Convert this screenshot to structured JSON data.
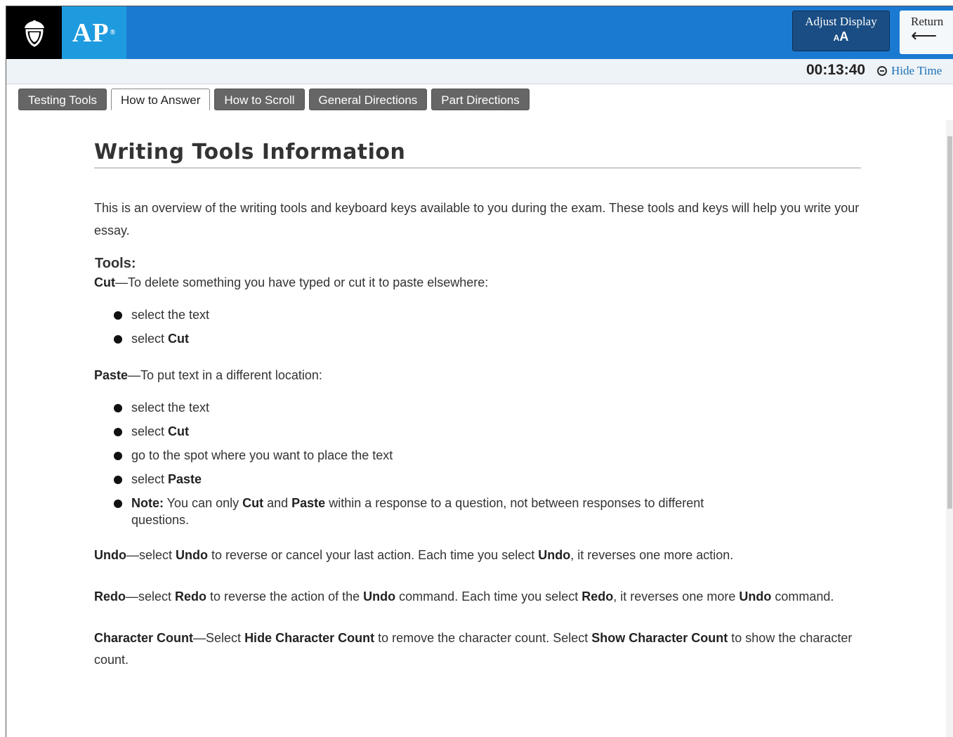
{
  "header": {
    "logo_text": "AP",
    "adjust_display": "Adjust Display",
    "adjust_icon": "AA",
    "return_label": "Return"
  },
  "timer": {
    "value": "00:13:40",
    "hide_label": "Hide Time"
  },
  "tabs": [
    {
      "label": "Testing Tools",
      "active": false
    },
    {
      "label": "How to Answer",
      "active": true
    },
    {
      "label": "How to Scroll",
      "active": false
    },
    {
      "label": "General Directions",
      "active": false
    },
    {
      "label": "Part Directions",
      "active": false
    }
  ],
  "content": {
    "title": "Writing Tools Information",
    "intro": "This is an overview of the writing tools and keyboard keys available to you during the exam. These tools and keys will help you write your essay.",
    "tools_heading": "Tools:",
    "cut": {
      "term": "Cut",
      "desc": "—To delete something you have typed or cut it to paste elsewhere:",
      "step1": "select the text",
      "step2_prefix": "select ",
      "step2_bold": "Cut"
    },
    "paste": {
      "term": "Paste",
      "desc": "—To put text in a different location:",
      "step1": "select the text",
      "step2_prefix": "select ",
      "step2_bold": "Cut",
      "step3": "go to the spot where you want to place the text",
      "step4_prefix": "select ",
      "step4_bold": "Paste",
      "note_label": "Note:",
      "note_t1": " You can only ",
      "note_b1": "Cut",
      "note_t2": " and ",
      "note_b2": "Paste",
      "note_t3": " within a response to a question, not between responses to different questions."
    },
    "undo": {
      "term": "Undo",
      "t1": "—select ",
      "b1": "Undo",
      "t2": " to reverse or cancel your last action. Each time you select ",
      "b2": "Undo",
      "t3": ", it reverses one more action."
    },
    "redo": {
      "term": "Redo",
      "t1": "—select ",
      "b1": "Redo",
      "t2": " to reverse the action of the ",
      "b2": "Undo",
      "t3": " command. Each time you select ",
      "b3": "Redo",
      "t4": ", it reverses one more ",
      "b4": "Undo",
      "t5": " command."
    },
    "charcount": {
      "term": "Character Count",
      "t1": "—Select ",
      "b1": "Hide Character Count",
      "t2": " to remove the character count. Select ",
      "b2": "Show Character Count",
      "t3": " to show the character count."
    }
  }
}
